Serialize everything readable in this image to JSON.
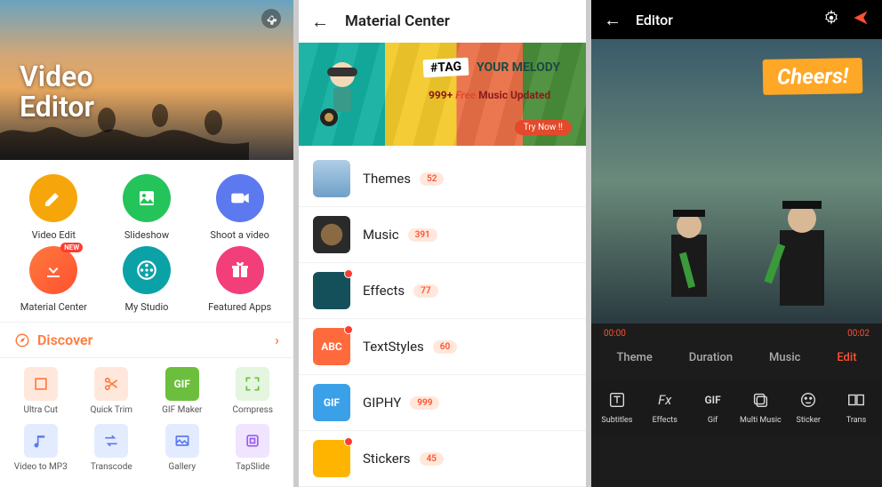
{
  "home": {
    "title_line1": "Video",
    "title_line2": "Editor",
    "main": [
      {
        "label": "Video Edit",
        "color": "c-yellow",
        "icon": "pencil-icon"
      },
      {
        "label": "Slideshow",
        "color": "c-green",
        "icon": "image-icon"
      },
      {
        "label": "Shoot a video",
        "color": "c-blue",
        "icon": "video-icon"
      },
      {
        "label": "Material Center",
        "color": "c-orange",
        "icon": "download-icon",
        "new": "NEW"
      },
      {
        "label": "My Studio",
        "color": "c-teal",
        "icon": "reel-icon"
      },
      {
        "label": "Featured Apps",
        "color": "c-pink",
        "icon": "gift-icon"
      }
    ],
    "discover_label": "Discover",
    "tools": [
      {
        "label": "Ultra Cut",
        "cls": "sq-o",
        "icon": "crop-icon"
      },
      {
        "label": "Quick Trim",
        "cls": "sq-o",
        "icon": "scissors-icon"
      },
      {
        "label": "GIF Maker",
        "cls": "sq-g",
        "txt": "GIF"
      },
      {
        "label": "Compress",
        "cls": "sq-gr",
        "icon": "compress-icon"
      },
      {
        "label": "Video to MP3",
        "cls": "sq-b",
        "icon": "music-note-icon"
      },
      {
        "label": "Transcode",
        "cls": "sq-b",
        "icon": "transcode-icon"
      },
      {
        "label": "Gallery",
        "cls": "sq-b",
        "icon": "gallery-icon"
      },
      {
        "label": "TapSlide",
        "cls": "sq-p",
        "icon": "tapslide-icon"
      }
    ]
  },
  "material": {
    "title": "Material Center",
    "banner": {
      "tag": "#TAG",
      "tag_rest": "YOUR MELODY",
      "line2_a": "999+",
      "line2_b": "Free",
      "line2_c": "Music Updated",
      "try": "Try Now !!"
    },
    "rows": [
      {
        "label": "Themes",
        "count": "52",
        "thumb": "th1"
      },
      {
        "label": "Music",
        "count": "391",
        "thumb": "th2"
      },
      {
        "label": "Effects",
        "count": "77",
        "thumb": "th3",
        "new": true
      },
      {
        "label": "TextStyles",
        "count": "60",
        "thumb": "th4",
        "txt": "ABC",
        "new": true
      },
      {
        "label": "GIPHY",
        "count": "999",
        "thumb": "th5",
        "txt": "GIF"
      },
      {
        "label": "Stickers",
        "count": "45",
        "thumb": "th6",
        "new": true
      }
    ]
  },
  "editor": {
    "title": "Editor",
    "overlay": "Cheers!",
    "time_start": "00:00",
    "time_end": "00:02",
    "tabs": [
      "Theme",
      "Duration",
      "Music",
      "Edit"
    ],
    "active_tab": 3,
    "tools": [
      {
        "label": "Subtitles",
        "icon": "text-box-icon"
      },
      {
        "label": "Effects",
        "icon": "fx-icon",
        "txt": "Fx"
      },
      {
        "label": "Gif",
        "icon": "gif-icon",
        "txt": "GIF"
      },
      {
        "label": "Multi Music",
        "icon": "layers-icon"
      },
      {
        "label": "Sticker",
        "icon": "sticker-icon"
      },
      {
        "label": "Trans",
        "icon": "transition-icon"
      }
    ]
  }
}
